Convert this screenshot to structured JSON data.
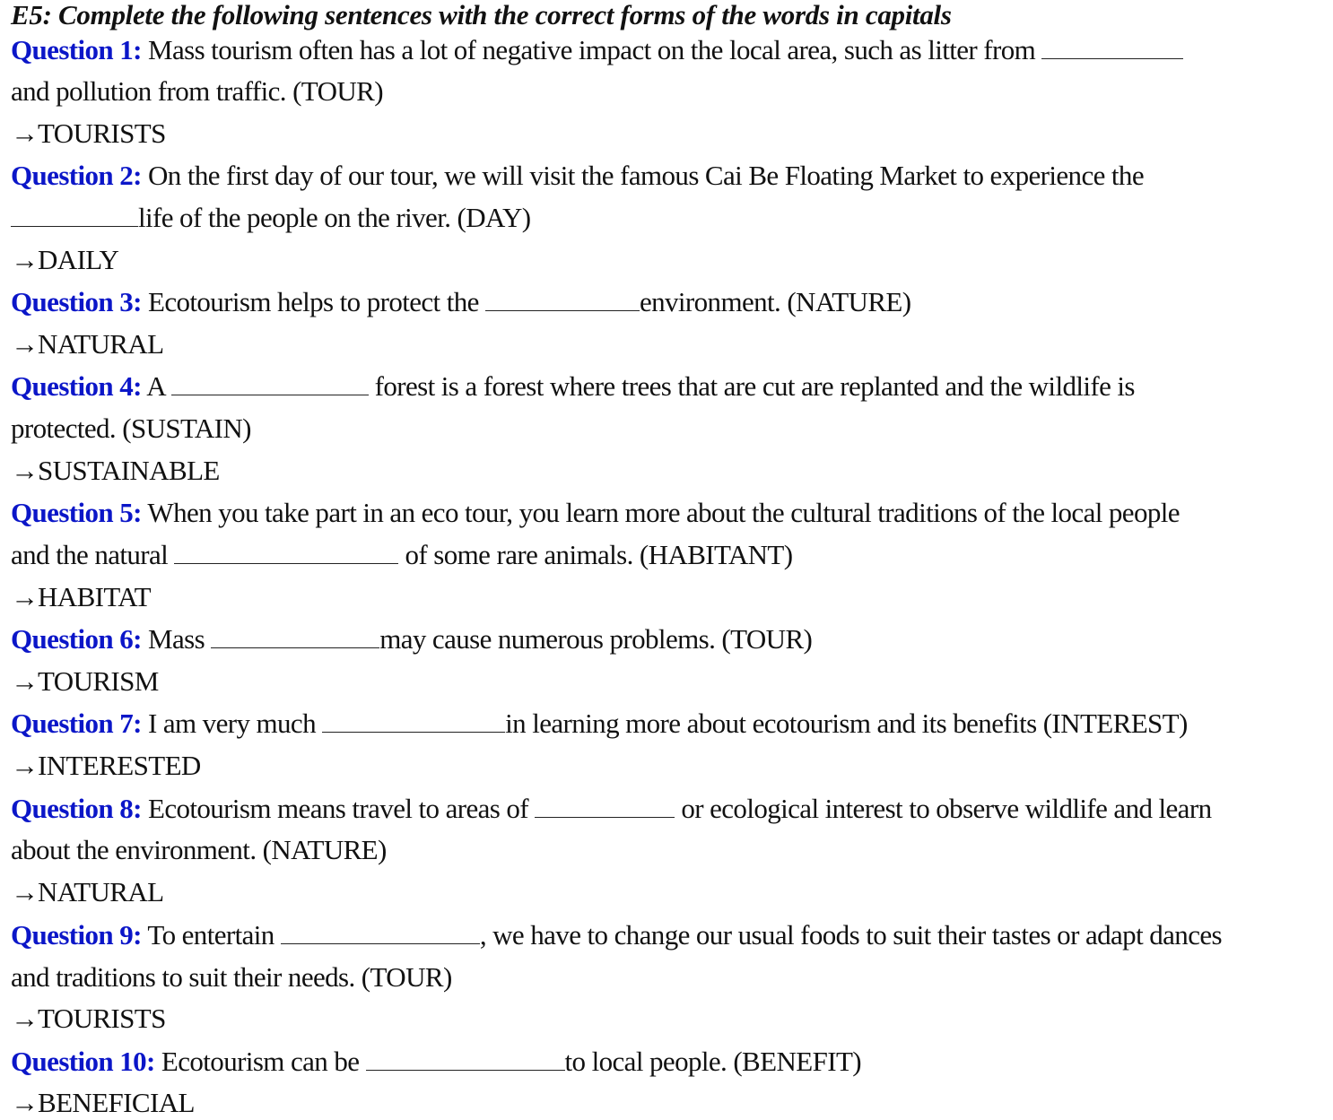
{
  "title": "E5: Complete the following sentences with the correct forms of the words in capitals",
  "arrow_symbol": "→",
  "questions": [
    {
      "label": "Question 1:",
      "before": " Mass tourism often has a lot of negative impact on the local area, such as litter from ",
      "after_line1": "",
      "line2": "and pollution from traffic. (TOUR)",
      "answer": "TOURISTS"
    },
    {
      "label": "Question 2:",
      "line1": " On the first day of our tour, we will visit the famous Cai Be Floating Market to experience the",
      "line2_after": "life of the people on the river. (DAY)",
      "answer": "DAILY"
    },
    {
      "label": "Question 3:",
      "before": " Ecotourism helps to protect the ",
      "after": "environment. (NATURE)",
      "answer": "NATURAL"
    },
    {
      "label": "Question 4:",
      "before": " A ",
      "after": " forest is a forest where trees that are cut are replanted and the wildlife is",
      "line2": "protected. (SUSTAIN)",
      "answer": "SUSTAINABLE"
    },
    {
      "label": "Question 5:",
      "line1": " When you take part in an eco tour, you learn more about the cultural traditions of the local people",
      "line2_before": "and the natural ",
      "line2_after": " of some rare animals. (HABITANT)",
      "answer": "HABITAT"
    },
    {
      "label": "Question 6:",
      "before": " Mass ",
      "after": "may cause numerous problems. (TOUR)",
      "answer": "TOURISM"
    },
    {
      "label": "Question 7:",
      "before": " I am very much ",
      "after": "in learning more about ecotourism and its benefits (INTEREST)",
      "answer": "INTERESTED"
    },
    {
      "label": "Question 8:",
      "before": " Ecotourism means travel to areas of ",
      "after": " or ecological interest to observe wildlife and learn",
      "line2": "about the environment. (NATURE)",
      "answer": "NATURAL"
    },
    {
      "label": "Question 9:",
      "before": " To entertain ",
      "after": ", we have to change our usual foods to suit their tastes or adapt dances",
      "line2": "and traditions to suit their needs. (TOUR)",
      "answer": "TOURISTS"
    },
    {
      "label": "Question 10:",
      "before": " Ecotourism can be ",
      "after": "to local people. (BENEFIT)",
      "answer": "BENEFICIAL"
    }
  ]
}
